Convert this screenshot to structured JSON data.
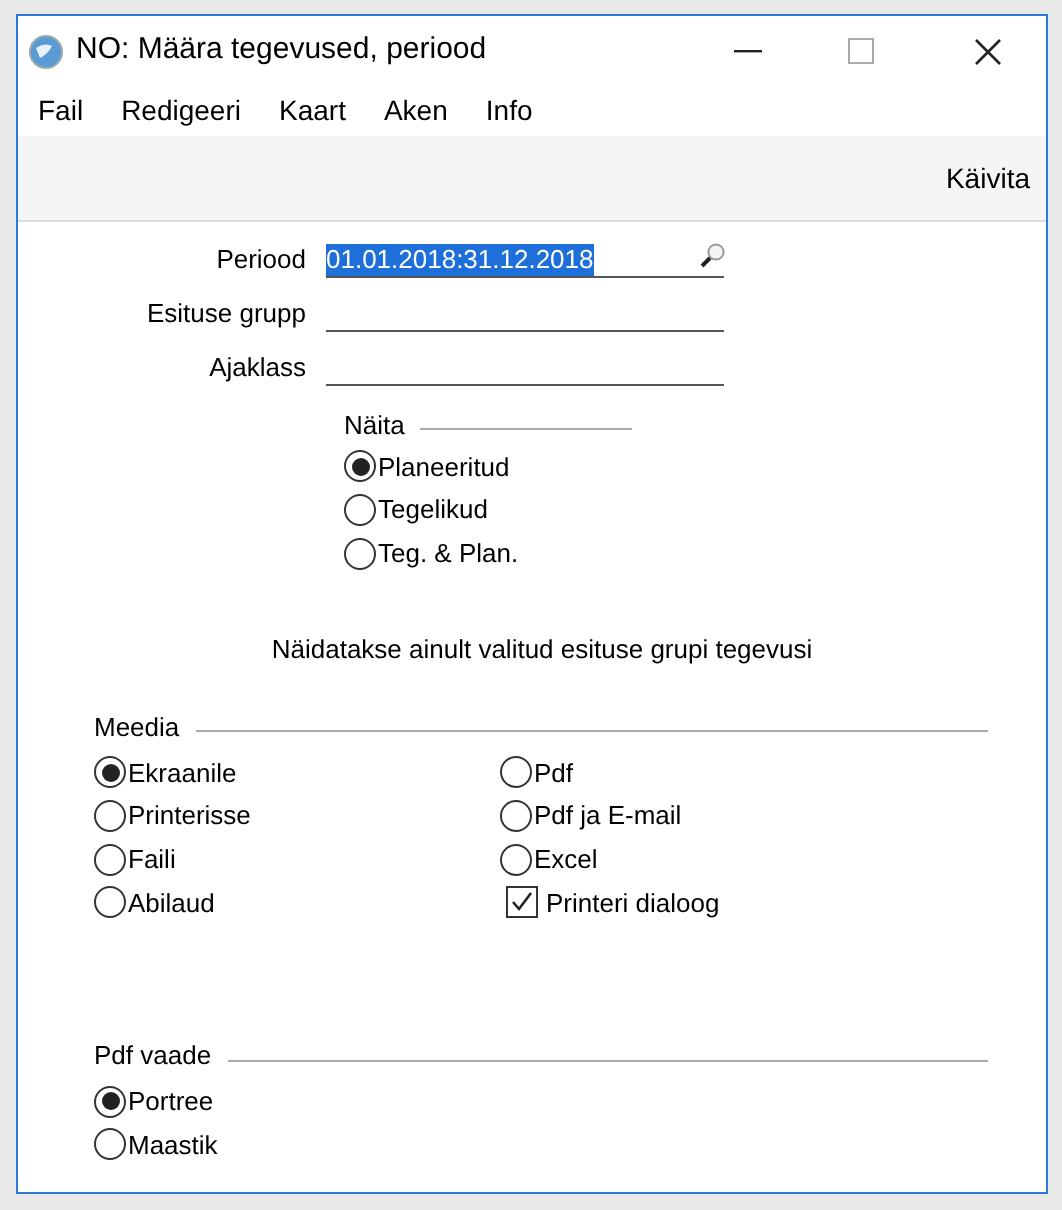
{
  "window": {
    "title": "NO: Määra tegevused, periood"
  },
  "menu": [
    "Fail",
    "Redigeeri",
    "Kaart",
    "Aken",
    "Info"
  ],
  "toolbar": {
    "button": "Käivita"
  },
  "fields": [
    {
      "label": "Periood",
      "value": "01.01.2018:31.12.2018",
      "highlighted": true,
      "lookup": true
    },
    {
      "label": "Esituse grupp"
    },
    {
      "label": "Ajaklass"
    }
  ],
  "show": {
    "label": "Näita",
    "options": [
      {
        "label": "Planeeritud",
        "selected": true
      },
      {
        "label": "Tegelikud",
        "selected": false
      },
      {
        "label": "Teg. & Plan.",
        "selected": false
      }
    ]
  },
  "note": "Näidatakse ainult valitud esituse grupi tegevusi",
  "media": {
    "label": "Meedia",
    "options": [
      {
        "kind": "radio",
        "label": "Ekraanile",
        "selected": true
      },
      {
        "kind": "radio",
        "label": "Printerisse",
        "selected": false
      },
      {
        "kind": "radio",
        "label": "Faili",
        "selected": false
      },
      {
        "kind": "radio",
        "label": "Abilaud",
        "selected": false
      },
      {
        "kind": "radio",
        "label": "Pdf",
        "selected": false
      },
      {
        "kind": "radio",
        "label": "Pdf ja E-mail",
        "selected": false
      },
      {
        "kind": "radio",
        "label": "Excel",
        "selected": false
      },
      {
        "kind": "checkbox",
        "label": "Printeri dialoog",
        "checked": true
      }
    ]
  },
  "pdf_view": {
    "label": "Pdf vaade",
    "options": [
      {
        "label": "Portree",
        "selected": true
      },
      {
        "label": "Maastik",
        "selected": false
      }
    ]
  }
}
